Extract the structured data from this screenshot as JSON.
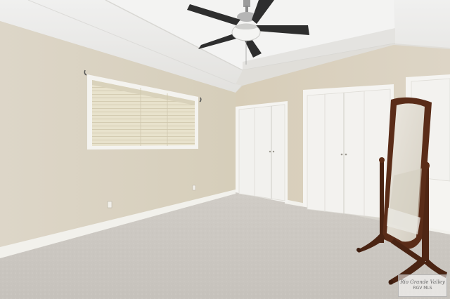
{
  "scene": {
    "description": "",
    "watermark": {
      "line1": "Rio Grande Valley",
      "line2": "RGV MLS"
    },
    "colors": {
      "wall_left": "#dcd5c7",
      "wall_back": "#d9d0bf",
      "ceiling": "#ececeb",
      "carpet": "#cbc7c1",
      "trim": "#f3f2ee",
      "doors": "#f4f3f0",
      "mirror_wood": "#5a2c18",
      "fan_blade": "#2e2e2e"
    }
  }
}
